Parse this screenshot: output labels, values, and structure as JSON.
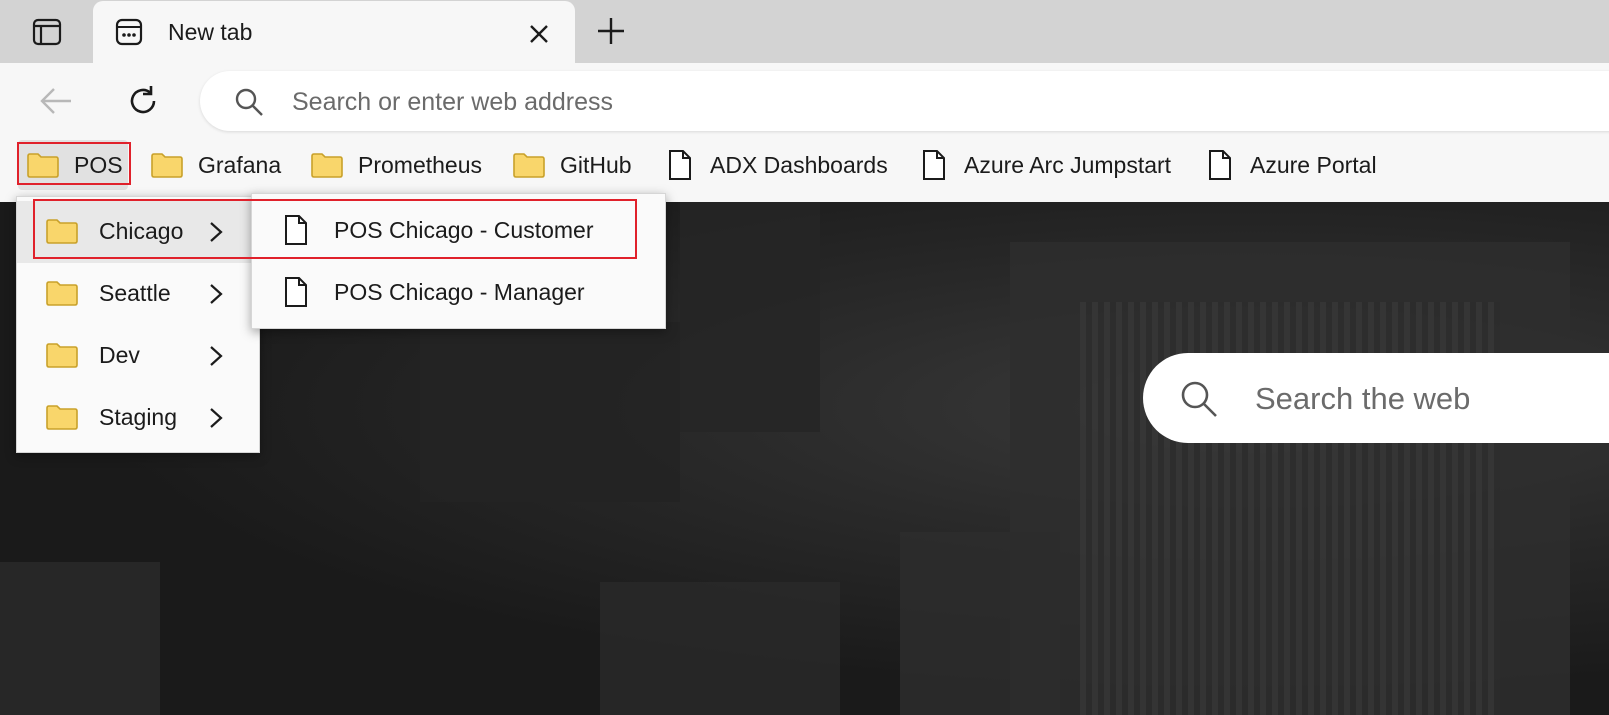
{
  "tab": {
    "title": "New tab"
  },
  "address_bar": {
    "placeholder": "Search or enter web address"
  },
  "favorites_bar": [
    {
      "label": "POS",
      "icon": "folder-icon"
    },
    {
      "label": "Grafana",
      "icon": "folder-icon"
    },
    {
      "label": "Prometheus",
      "icon": "folder-icon"
    },
    {
      "label": "GitHub",
      "icon": "folder-icon"
    },
    {
      "label": "ADX Dashboards",
      "icon": "page-icon"
    },
    {
      "label": "Azure Arc Jumpstart",
      "icon": "page-icon"
    },
    {
      "label": "Azure Portal",
      "icon": "page-icon"
    }
  ],
  "pos_menu": [
    {
      "label": "Chicago",
      "icon": "folder-icon"
    },
    {
      "label": "Seattle",
      "icon": "folder-icon"
    },
    {
      "label": "Dev",
      "icon": "folder-icon"
    },
    {
      "label": "Staging",
      "icon": "folder-icon"
    }
  ],
  "chicago_menu": [
    {
      "label": "POS Chicago - Customer",
      "icon": "page-icon"
    },
    {
      "label": "POS Chicago - Manager",
      "icon": "page-icon"
    }
  ],
  "web_search": {
    "placeholder": "Search the web"
  },
  "colors": {
    "highlight": "#e0212b",
    "folder": "#f9d66b"
  }
}
